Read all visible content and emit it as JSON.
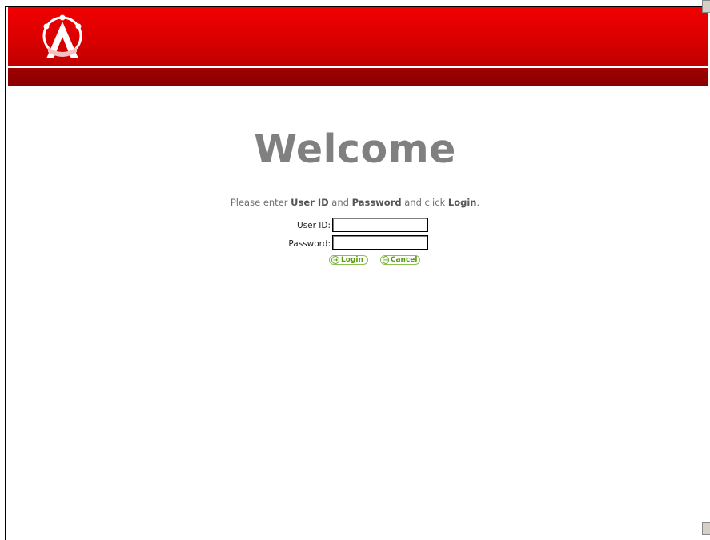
{
  "page": {
    "title": "Welcome",
    "instructions": {
      "part1": "Please enter ",
      "user_id": "User ID",
      "part2": " and ",
      "password": "Password",
      "part3": " and click ",
      "login": "Login",
      "part4": "."
    }
  },
  "form": {
    "user_id_label": "User ID:",
    "user_id_value": "",
    "password_label": "Password:",
    "password_value": "",
    "login_button": "Login",
    "cancel_button": "Cancel"
  },
  "colors": {
    "header_red": "#dd0000",
    "subbar_dark_red": "#8a0000",
    "title_gray": "#808080",
    "button_green": "#5a9a10"
  },
  "icons": {
    "logo": "company-logo-icon",
    "login_arrow": "arrow-right-icon",
    "cancel_arrow": "arrow-right-icon"
  }
}
